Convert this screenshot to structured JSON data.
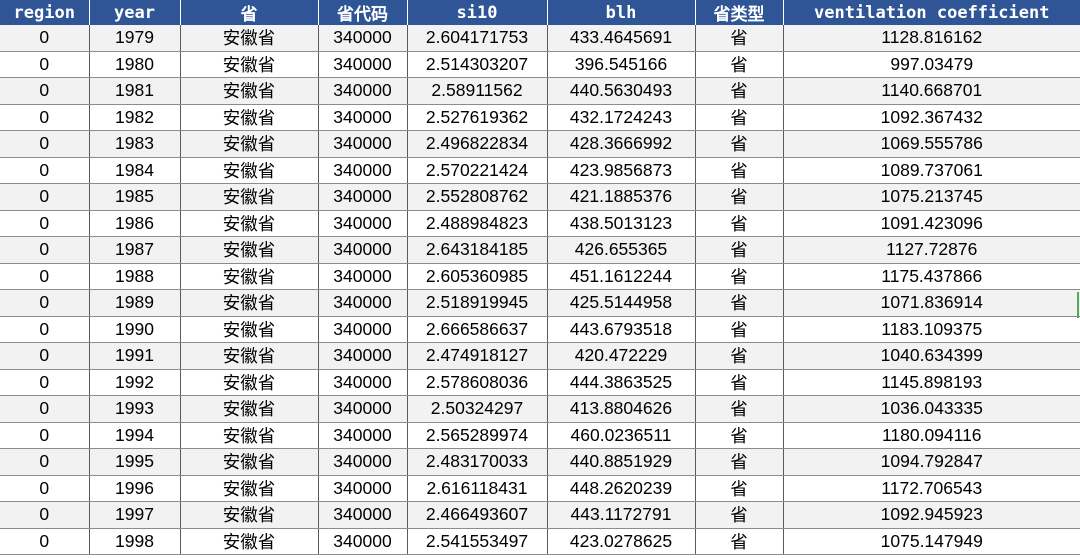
{
  "table": {
    "headers": [
      "region",
      "year",
      "省",
      "省代码",
      "si10",
      "blh",
      "省类型",
      "ventilation coefficient"
    ],
    "rows": [
      [
        "0",
        "1979",
        "安徽省",
        "340000",
        "2.604171753",
        "433.4645691",
        "省",
        "1128.816162"
      ],
      [
        "0",
        "1980",
        "安徽省",
        "340000",
        "2.514303207",
        "396.545166",
        "省",
        "997.03479"
      ],
      [
        "0",
        "1981",
        "安徽省",
        "340000",
        "2.58911562",
        "440.5630493",
        "省",
        "1140.668701"
      ],
      [
        "0",
        "1982",
        "安徽省",
        "340000",
        "2.527619362",
        "432.1724243",
        "省",
        "1092.367432"
      ],
      [
        "0",
        "1983",
        "安徽省",
        "340000",
        "2.496822834",
        "428.3666992",
        "省",
        "1069.555786"
      ],
      [
        "0",
        "1984",
        "安徽省",
        "340000",
        "2.570221424",
        "423.9856873",
        "省",
        "1089.737061"
      ],
      [
        "0",
        "1985",
        "安徽省",
        "340000",
        "2.552808762",
        "421.1885376",
        "省",
        "1075.213745"
      ],
      [
        "0",
        "1986",
        "安徽省",
        "340000",
        "2.488984823",
        "438.5013123",
        "省",
        "1091.423096"
      ],
      [
        "0",
        "1987",
        "安徽省",
        "340000",
        "2.643184185",
        "426.655365",
        "省",
        "1127.72876"
      ],
      [
        "0",
        "1988",
        "安徽省",
        "340000",
        "2.605360985",
        "451.1612244",
        "省",
        "1175.437866"
      ],
      [
        "0",
        "1989",
        "安徽省",
        "340000",
        "2.518919945",
        "425.5144958",
        "省",
        "1071.836914"
      ],
      [
        "0",
        "1990",
        "安徽省",
        "340000",
        "2.666586637",
        "443.6793518",
        "省",
        "1183.109375"
      ],
      [
        "0",
        "1991",
        "安徽省",
        "340000",
        "2.474918127",
        "420.472229",
        "省",
        "1040.634399"
      ],
      [
        "0",
        "1992",
        "安徽省",
        "340000",
        "2.578608036",
        "444.3863525",
        "省",
        "1145.898193"
      ],
      [
        "0",
        "1993",
        "安徽省",
        "340000",
        "2.50324297",
        "413.8804626",
        "省",
        "1036.043335"
      ],
      [
        "0",
        "1994",
        "安徽省",
        "340000",
        "2.565289974",
        "460.0236511",
        "省",
        "1180.094116"
      ],
      [
        "0",
        "1995",
        "安徽省",
        "340000",
        "2.483170033",
        "440.8851929",
        "省",
        "1094.792847"
      ],
      [
        "0",
        "1996",
        "安徽省",
        "340000",
        "2.616118431",
        "448.2620239",
        "省",
        "1172.706543"
      ],
      [
        "0",
        "1997",
        "安徽省",
        "340000",
        "2.466493607",
        "443.1172791",
        "省",
        "1092.945923"
      ],
      [
        "0",
        "1998",
        "安徽省",
        "340000",
        "2.541553497",
        "423.0278625",
        "省",
        "1075.147949"
      ]
    ]
  }
}
